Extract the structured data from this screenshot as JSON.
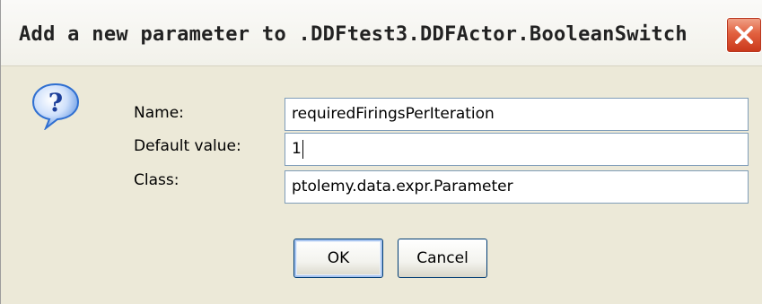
{
  "window": {
    "title": "Add a new parameter to .DDFtest3.DDFActor.BooleanSwitch",
    "close_icon": "close-icon"
  },
  "icon": {
    "name": "question-icon",
    "glyph": "?"
  },
  "form": {
    "name_label": "Name:",
    "name_value": "requiredFiringsPerIteration",
    "default_label": "Default value:",
    "default_value": "1",
    "class_label": "Class:",
    "class_value": "ptolemy.data.expr.Parameter"
  },
  "buttons": {
    "ok_label": "OK",
    "cancel_label": "Cancel"
  },
  "colors": {
    "dialog_bg": "#ece9d8",
    "close_button_red": "#e2613f",
    "field_border": "#7f9db9",
    "help_icon_blue": "#2f6fd1"
  }
}
